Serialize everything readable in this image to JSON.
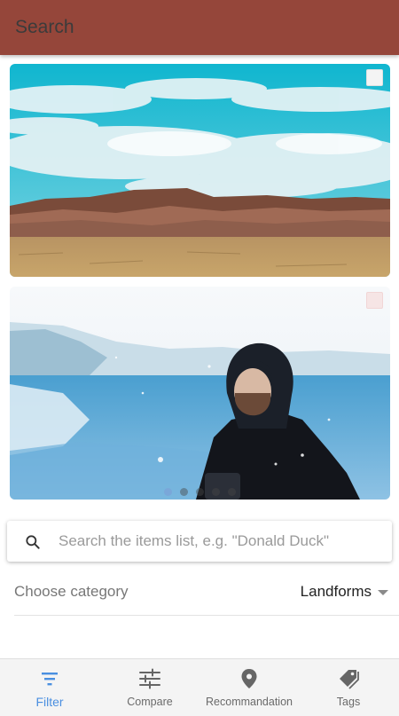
{
  "appbar": {
    "title": "Search",
    "color": "#95463a"
  },
  "gallery": [
    {
      "scene": "desert mesa landscape under cloudy blue sky",
      "selected": false
    },
    {
      "scene": "man in dark hooded jacket by snowy lake",
      "selected": false
    }
  ],
  "carousel": {
    "page_count": 5,
    "active_page": 1
  },
  "search": {
    "placeholder": "Search the items list, e.g. \"Donald Duck\"",
    "value": "",
    "icon": "search-icon"
  },
  "category": {
    "label": "Choose category",
    "value": "Landforms",
    "icon": "chevron-down-icon"
  },
  "bottom_nav": {
    "accent": "#4a8fe0",
    "items": [
      {
        "label": "Filter",
        "icon": "filter-icon",
        "active": true
      },
      {
        "label": "Compare",
        "icon": "sliders-icon",
        "active": false
      },
      {
        "label": "Recommandation",
        "icon": "location-pin-icon",
        "active": false
      },
      {
        "label": "Tags",
        "icon": "tag-icon",
        "active": false
      }
    ]
  }
}
